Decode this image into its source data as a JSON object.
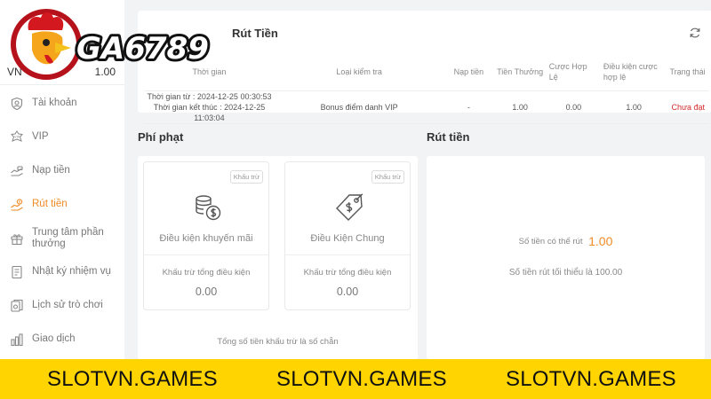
{
  "brand": {
    "logo_text": "GA6789"
  },
  "sidebar": {
    "currency": "VN",
    "balance": "1.00",
    "items": [
      {
        "label": "Tài khoản",
        "icon": "user-shield-icon"
      },
      {
        "label": "VIP",
        "icon": "vip-icon"
      },
      {
        "label": "Nạp tiền",
        "icon": "deposit-icon"
      },
      {
        "label": "Rút tiền",
        "icon": "withdraw-hand-icon",
        "active": true
      },
      {
        "label": "Trung tâm phần thưởng",
        "icon": "gift-icon"
      },
      {
        "label": "Nhật ký nhiệm vụ",
        "icon": "task-log-icon"
      },
      {
        "label": "Lịch sử trò chơi",
        "icon": "game-history-icon"
      },
      {
        "label": "Giao dịch",
        "icon": "transaction-icon"
      }
    ]
  },
  "bonus_panel": {
    "title": "Rút Tiền",
    "columns": [
      "Thời gian",
      "Loại kiểm tra",
      "Nạp tiền",
      "Tiền Thưởng",
      "Cược Hợp Lệ",
      "Điều kiện cược hợp lệ",
      "Trạng thái"
    ],
    "rows": [
      {
        "time_start": "Thời gian từ : 2024-12-25 00:30:53",
        "time_end": "Thời gian kết thúc : 2024-12-25 11:03:04",
        "type": "Bonus điểm danh VIP",
        "deposit": "-",
        "bonus": "1.00",
        "valid_bet": "0.00",
        "required_bet": "1.00",
        "status": "Chưa đạt"
      }
    ]
  },
  "penalty": {
    "title": "Phí phạt",
    "cards": [
      {
        "badge": "Khấu trừ",
        "name": "Điều kiện khuyến mãi",
        "sub": "Khấu trừ tổng điều kiện",
        "value": "0.00",
        "icon": "coins-dollar-icon"
      },
      {
        "badge": "Khấu trừ",
        "name": "Điều Kiện Chung",
        "sub": "Khấu trừ tổng điều kiện",
        "value": "0.00",
        "icon": "price-tag-icon"
      }
    ],
    "total_note": "Tổng số tiền khấu trừ là số chẵn"
  },
  "withdraw": {
    "title": "Rút tiền",
    "available_label": "Số tiền có thể rút",
    "available_value": "1.00",
    "min_note": "Số tiền rút tối thiểu là 100.00"
  },
  "banner": {
    "texts": [
      "SLOTVN.GAMES",
      "SLOTVN.GAMES",
      "SLOTVN.GAMES"
    ]
  },
  "colors": {
    "accent": "#f08a24",
    "status_red": "#d42b2b",
    "banner": "#ffd400"
  }
}
